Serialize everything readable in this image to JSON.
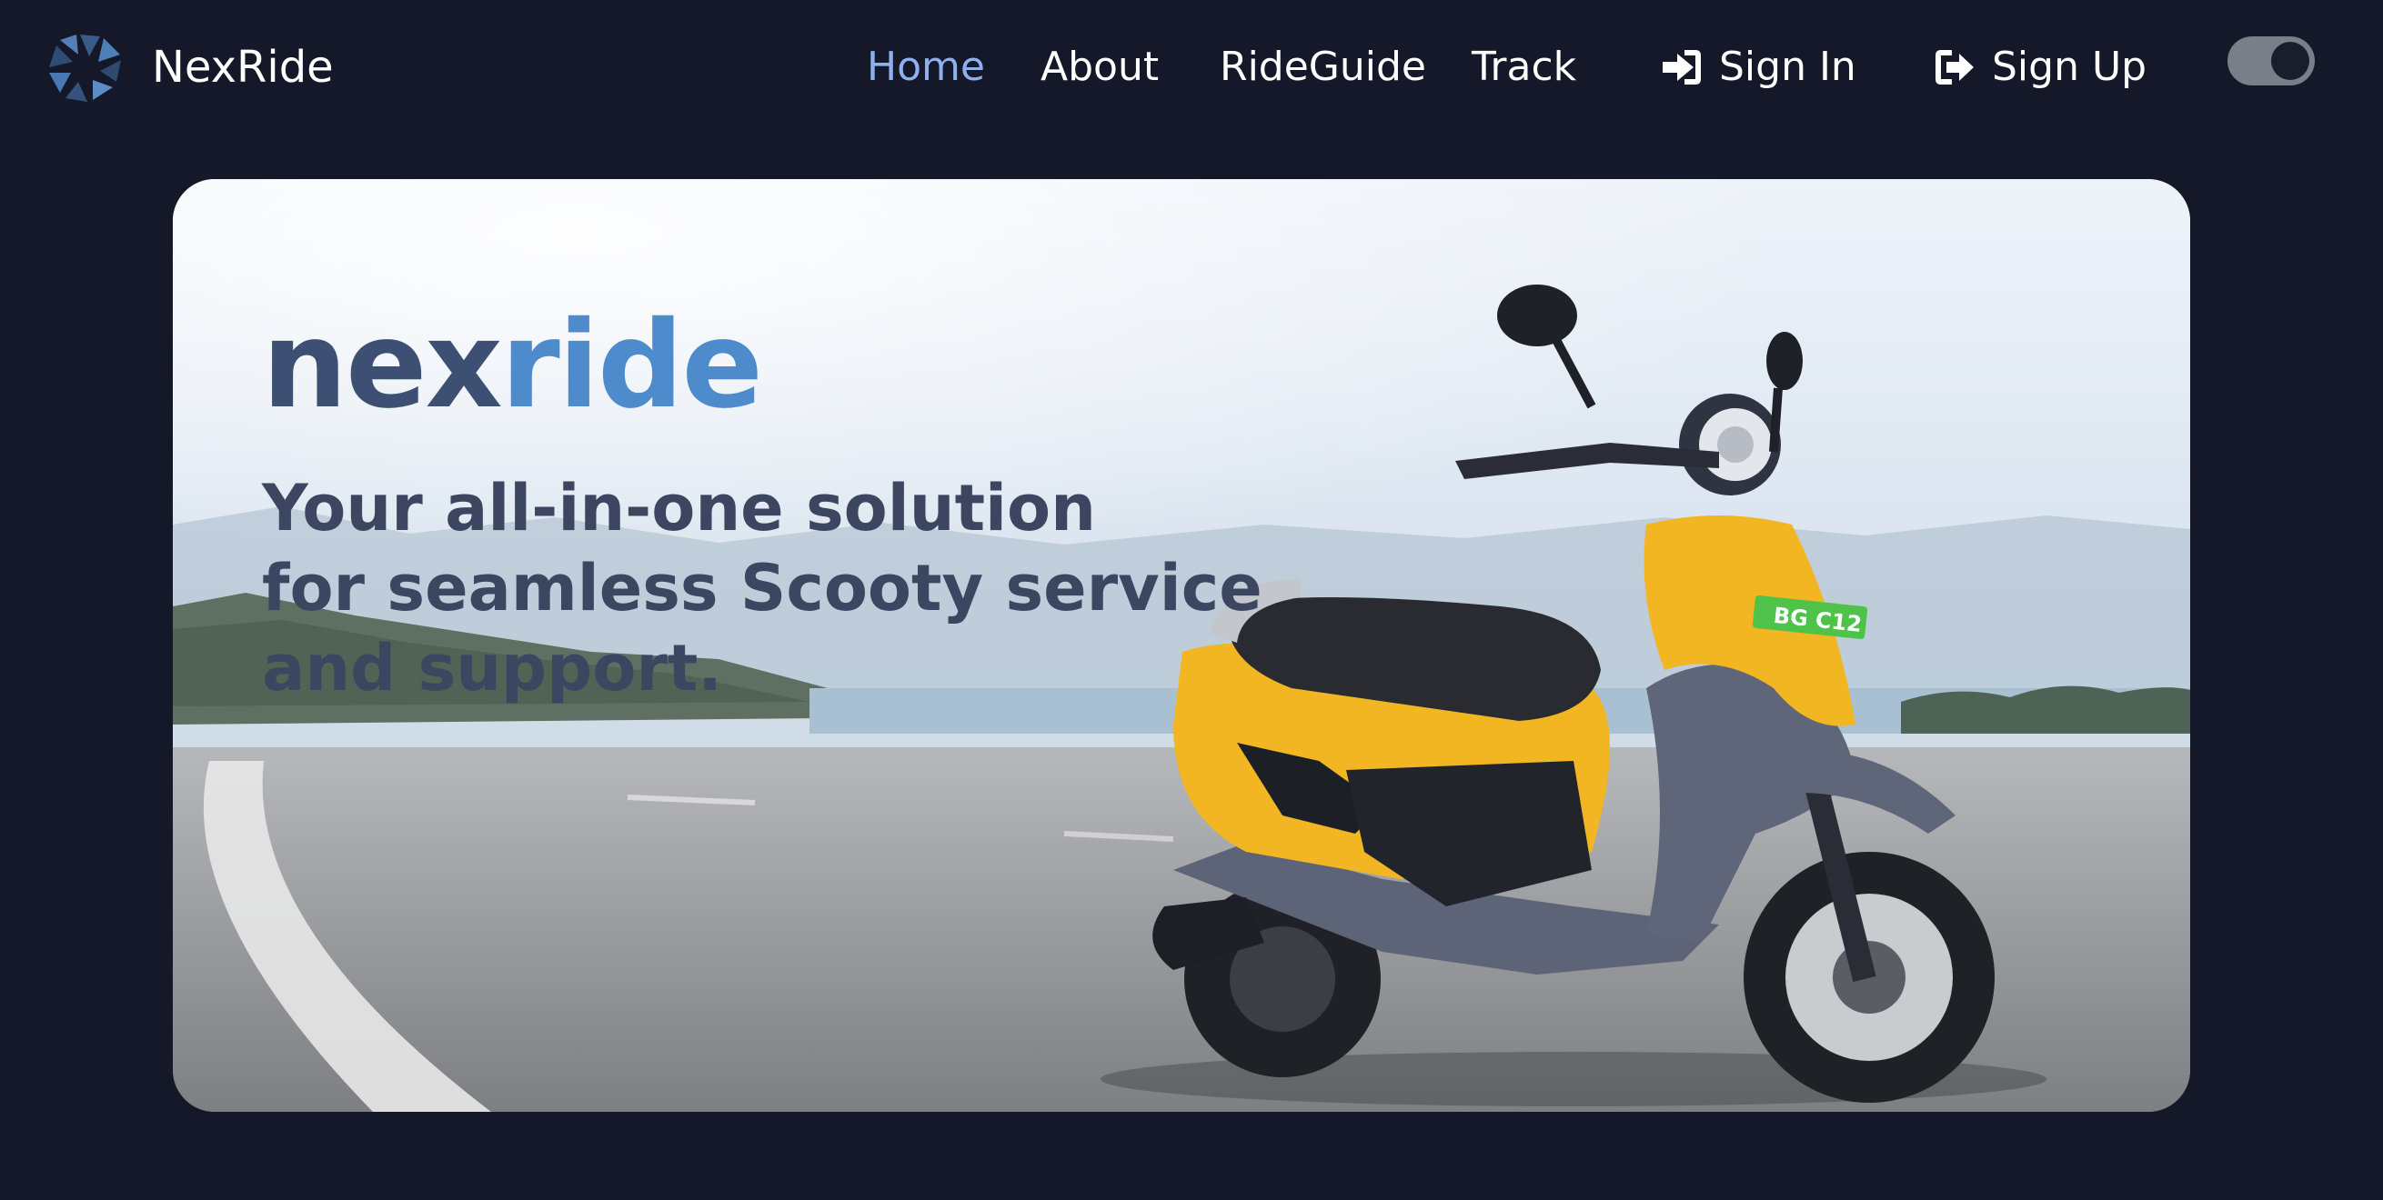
{
  "brand": {
    "name": "NexRide",
    "logo_icon": "aperture-logo-icon"
  },
  "nav": {
    "links": [
      {
        "label": "Home",
        "active": true
      },
      {
        "label": "About",
        "active": false
      },
      {
        "label": "RideGuide",
        "active": false
      },
      {
        "label": "Track",
        "active": false
      }
    ],
    "sign_in": {
      "label": "Sign In",
      "icon": "sign-in-icon"
    },
    "sign_up": {
      "label": "Sign Up",
      "icon": "sign-out-icon"
    },
    "theme_toggle": {
      "state": "on"
    }
  },
  "hero": {
    "wordmark_part1": "nex",
    "wordmark_part2": "ride",
    "tagline_line1": "Your all-in-one solution",
    "tagline_line2": "for seamless Scooty service",
    "tagline_line3": "and support.",
    "plate": "BG C12"
  },
  "colors": {
    "background": "#141828",
    "nav_active": "#8fb0ee",
    "wordmark_dark": "#3d5074",
    "wordmark_light": "#4d8bcc",
    "scooter_body": "#f2b622"
  }
}
